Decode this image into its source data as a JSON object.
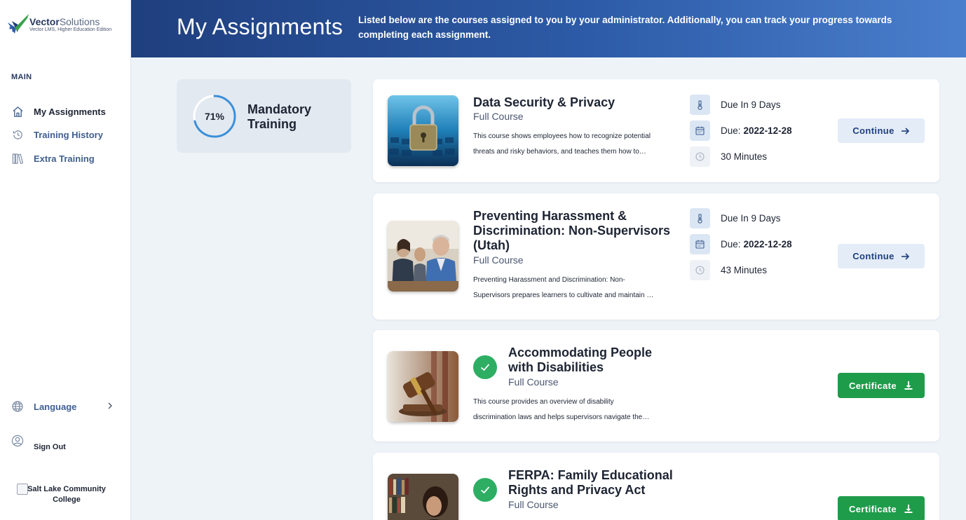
{
  "brand": {
    "name_bold": "Vector",
    "name_light": "Solutions",
    "tagline": "Vector LMS, Higher Education Edition"
  },
  "sidebar": {
    "section_label": "MAIN",
    "items": [
      {
        "label": "My Assignments",
        "icon": "home-icon",
        "active": true
      },
      {
        "label": "Training History",
        "icon": "history-icon",
        "active": false
      },
      {
        "label": "Extra Training",
        "icon": "books-icon",
        "active": false
      }
    ],
    "language_label": "Language",
    "signout_label": "Sign Out",
    "college_name": "Salt Lake Community College"
  },
  "header": {
    "title": "My Assignments",
    "description": "Listed below are the courses assigned to you by your administrator. Additionally, you can track your progress towards completing each assignment."
  },
  "progress": {
    "percent_label": "71%",
    "percent_value": 0.71,
    "title": "Mandatory Training"
  },
  "colors": {
    "header_dark": "#1f3f7e",
    "header_light": "#4a7fcd",
    "ring": "#3a8fd9",
    "success": "#1f9c4a",
    "check": "#2dae63"
  },
  "courses": [
    {
      "title": "Data Security & Privacy",
      "type": "Full Course",
      "desc_line1": "This course shows employees how to recognize potential",
      "desc_line2": "threats and risky behaviors, and teaches them how to…",
      "due_in": "Due In 9 Days",
      "due_label": "Due:",
      "due_date": "2022-12-28",
      "duration": "30 Minutes",
      "action": "Continue",
      "completed": false
    },
    {
      "title": "Preventing Harassment & Discrimination: Non-Supervisors (Utah)",
      "type": "Full Course",
      "desc_line1": "Preventing Harassment and Discrimination: Non-",
      "desc_line2": "Supervisors prepares learners to cultivate and maintain …",
      "due_in": "Due In 9 Days",
      "due_label": "Due:",
      "due_date": "2022-12-28",
      "duration": "43 Minutes",
      "action": "Continue",
      "completed": false
    },
    {
      "title": "Accommodating People with Disabilities",
      "type": "Full Course",
      "desc_line1": "This course provides an overview of disability",
      "desc_line2": "discrimination laws and helps supervisors navigate the…",
      "action": "Certificate",
      "completed": true
    },
    {
      "title": "FERPA: Family Educational Rights and Privacy Act",
      "type": "Full Course",
      "action": "Certificate",
      "completed": true
    }
  ]
}
